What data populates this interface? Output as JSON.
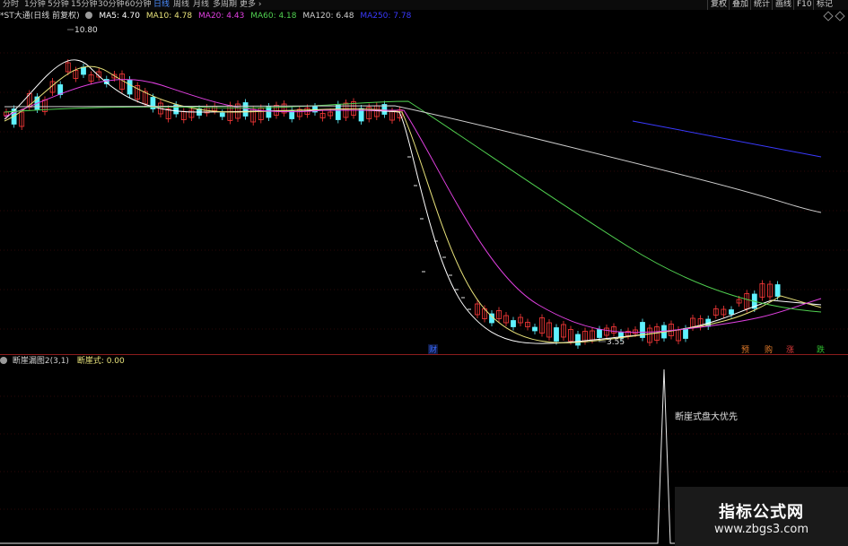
{
  "toolbar": {
    "periods": [
      "分时",
      "1分钟",
      "5分钟",
      "15分钟",
      "30分钟",
      "60分钟",
      "日线",
      "周线",
      "月线",
      "多周期",
      "更多"
    ],
    "active_period": "日线",
    "tools": [
      "复权",
      "叠加",
      "统计",
      "画线",
      "F10",
      "标记"
    ]
  },
  "main": {
    "title": "*ST大通(日线 前复权)",
    "ma": [
      {
        "label": "MA5: 4.70",
        "color": "#ffffff"
      },
      {
        "label": "MA10: 4.78",
        "color": "#e8e27a"
      },
      {
        "label": "MA20: 4.43",
        "color": "#e040e0"
      },
      {
        "label": "MA60: 4.18",
        "color": "#50d050"
      },
      {
        "label": "MA120: 6.48",
        "color": "#cfcfcf"
      },
      {
        "label": "MA250: 7.78",
        "color": "#3a3aff"
      }
    ],
    "high_label": "10.80",
    "low_label": "3.55",
    "event_markers": [
      {
        "text": "财",
        "color": "#3a6cff"
      },
      {
        "text": "预",
        "color": "#e07a2a"
      },
      {
        "text": "购",
        "color": "#e07a2a"
      },
      {
        "text": "涨",
        "color": "#e03a3a"
      },
      {
        "text": "跌",
        "color": "#30c030"
      }
    ]
  },
  "indicator": {
    "name": "断崖漏图2(3,1)",
    "value_label": "断崖式: 0.00",
    "annotation": "断崖式盘大优先"
  },
  "watermark": {
    "title": "指标公式网",
    "url": "www.zbgs3.com"
  }
}
